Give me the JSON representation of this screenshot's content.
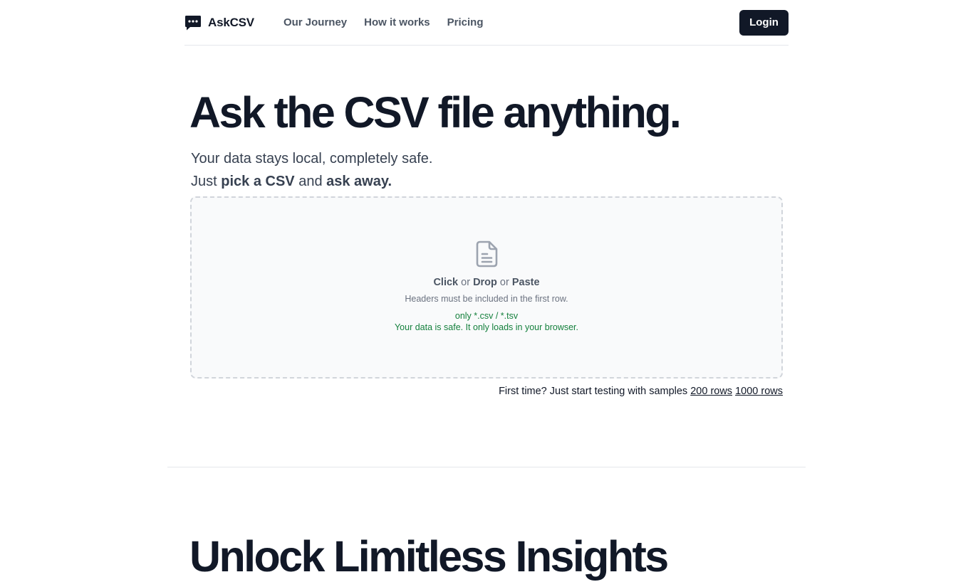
{
  "header": {
    "brand": "AskCSV",
    "nav": [
      "Our Journey",
      "How it works",
      "Pricing"
    ],
    "login_label": "Login"
  },
  "hero": {
    "title": "Ask the CSV file anything.",
    "line1": "Your data stays local, completely safe.",
    "line2_prefix": "Just ",
    "line2_bold1": "pick a CSV",
    "line2_mid": " and ",
    "line2_bold2": "ask away."
  },
  "dropzone": {
    "icon": "file-text-icon",
    "click": "Click",
    "or1": " or ",
    "drop": "Drop",
    "or2": " or ",
    "paste": "Paste",
    "headers_note": "Headers must be included in the first row.",
    "types_note": "only *.csv / *.tsv",
    "safe_note": "Your data is safe. It only loads in your browser."
  },
  "samples": {
    "prefix": "First time? Just start testing with samples ",
    "link1": "200 rows",
    "link2": "1000 rows"
  },
  "section2": {
    "title": "Unlock Limitless Insights"
  },
  "colors": {
    "primary": "#111827",
    "muted": "#6b7280",
    "success": "#15803d",
    "dropzone_bg": "#f9fafb",
    "border": "#e5e7eb"
  }
}
